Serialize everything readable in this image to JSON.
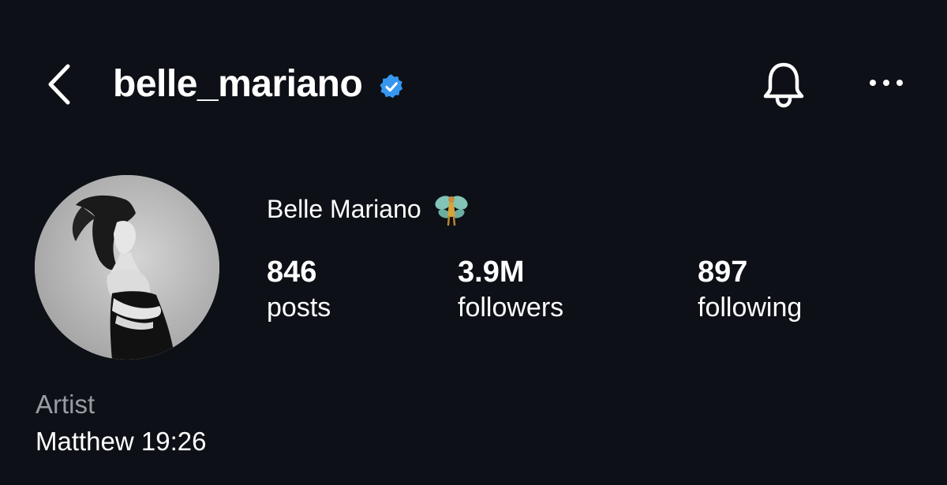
{
  "header": {
    "username": "belle_mariano",
    "verified": true,
    "back_icon": "chevron-left-icon",
    "verified_icon": "verified-badge-icon",
    "bell_icon": "bell-icon",
    "more_icon": "more-horizontal-icon"
  },
  "profile": {
    "display_name": "Belle Mariano",
    "name_emoji_icon": "fairy-icon",
    "avatar_icon": "profile-photo"
  },
  "stats": {
    "posts": {
      "value": "846",
      "label": "posts"
    },
    "followers": {
      "value": "3.9M",
      "label": "followers"
    },
    "following": {
      "value": "897",
      "label": "following"
    }
  },
  "bio": {
    "category": "Artist",
    "text": "Matthew 19:26"
  },
  "colors": {
    "background": "#0d1016",
    "text": "#ffffff",
    "muted_text": "#9a9ca3",
    "verified_blue": "#3797f0"
  }
}
